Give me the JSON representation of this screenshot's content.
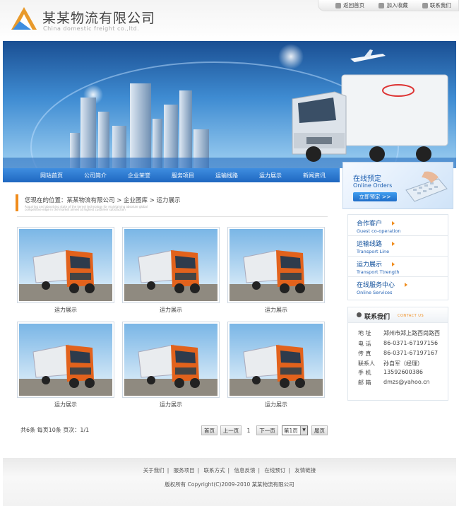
{
  "header": {
    "brand_cn": "某某物流有限公司",
    "brand_en": "China domestic freight co.,ltd.",
    "top_links": [
      "返回首页",
      "加入收藏",
      "联系我们"
    ]
  },
  "nav": {
    "items": [
      "网站首页",
      "公司简介",
      "企业荣誉",
      "服务项目",
      "运输线路",
      "运力展示",
      "新闻资讯"
    ]
  },
  "breadcrumb": {
    "text": "您现在的位置：某某物流有限公司 > 企业图库 > 运力展示",
    "subtext": "Acquiring and absorbing state of the kernel technology for maintaining absolute global competitive edge in the market aimed at highest customer satisfaction"
  },
  "gallery": {
    "items": [
      {
        "caption": "运力展示"
      },
      {
        "caption": "运力展示"
      },
      {
        "caption": "运力展示"
      },
      {
        "caption": "运力展示"
      },
      {
        "caption": "运力展示"
      },
      {
        "caption": "运力展示"
      }
    ]
  },
  "pager": {
    "info": "共6条  每页10条  页次：1/1",
    "first": "首页",
    "prev": "上一页",
    "page_number": "1",
    "next": "下一页",
    "select_value": "第1页",
    "last": "尾页"
  },
  "sidebar": {
    "promo": {
      "title": "在线预定",
      "subtitle": "Online Orders",
      "button": "立即预定 >>"
    },
    "menu": [
      {
        "cn": "合作客户",
        "en": "Guest co-operation"
      },
      {
        "cn": "运输线路",
        "en": "Transport Line"
      },
      {
        "cn": "运力展示",
        "en": "Transport Ttrength"
      },
      {
        "cn": "在线服务中心",
        "en": "Online Services"
      }
    ],
    "contact": {
      "title": "联系我们",
      "subtitle": "CONTACT US",
      "rows": [
        {
          "label": "地  址",
          "value": "郑州市郑上路西岗路西"
        },
        {
          "label": "电  话",
          "value": "86-0371-67197156"
        },
        {
          "label": "传  真",
          "value": "86-0371-67197167"
        },
        {
          "label": "联系人",
          "value": "孙自军（经理）"
        },
        {
          "label": "手  机",
          "value": "13592600386"
        },
        {
          "label": "邮  箱",
          "value": "dmzs@yahoo.cn"
        }
      ]
    }
  },
  "footer": {
    "links": [
      "关于我们",
      "服务项目",
      "联系方式",
      "信息反馈",
      "在线预订",
      "友情链接"
    ],
    "separator": "|",
    "copyright": "版权所有  Copyright(C)2009-2010 某某物流有限公司"
  },
  "colors": {
    "accent_orange": "#f08c1c",
    "nav_blue": "#2a77d0",
    "link_blue": "#0d4d99"
  }
}
